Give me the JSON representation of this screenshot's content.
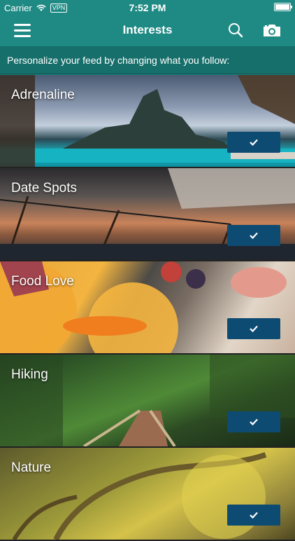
{
  "status_bar": {
    "carrier": "Carrier",
    "vpn": "VPN",
    "time": "7:52 PM"
  },
  "navbar": {
    "title": "Interests",
    "menu_icon": "hamburger-menu-icon",
    "search_icon": "search-icon",
    "camera_icon": "camera-icon"
  },
  "subtitle": "Personalize your feed by changing what you follow:",
  "interests": [
    {
      "label": "Adrenaline",
      "followed": true
    },
    {
      "label": "Date Spots",
      "followed": true
    },
    {
      "label": "Food Love",
      "followed": true
    },
    {
      "label": "Hiking",
      "followed": true
    },
    {
      "label": "Nature",
      "followed": true
    }
  ],
  "colors": {
    "header": "#1f8a84",
    "subtitle_bg": "#166f6b",
    "check_button": "#0e4b73"
  }
}
